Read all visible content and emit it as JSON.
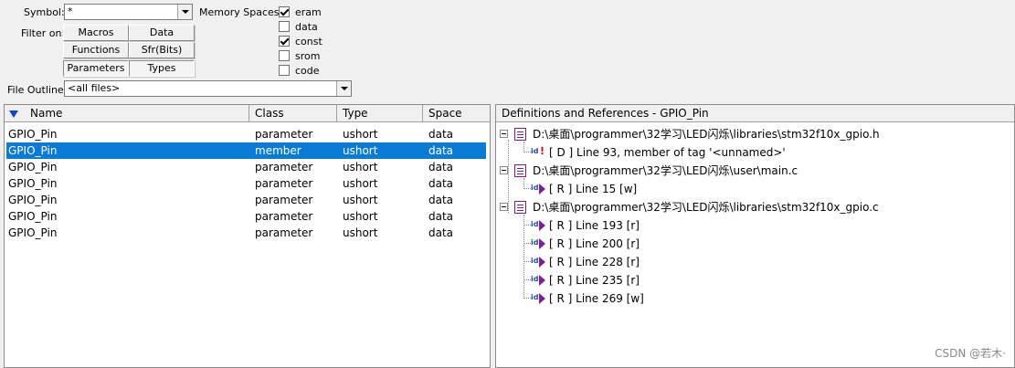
{
  "top": {
    "symbol_label": "Symbol:",
    "symbol_value": "*",
    "filter_label": "Filter on:",
    "filter_buttons": [
      "Macros",
      "Data",
      "Functions",
      "Sfr(Bits)",
      "Parameters",
      "Types"
    ],
    "memory_label": "Memory Spaces:",
    "memory_spaces": [
      {
        "label": "eram",
        "checked": true
      },
      {
        "label": "data",
        "checked": false
      },
      {
        "label": "const",
        "checked": true
      },
      {
        "label": "srom",
        "checked": false
      },
      {
        "label": "code",
        "checked": false
      }
    ],
    "file_outline_label": "File Outline:",
    "file_outline_value": "<all files>"
  },
  "symbols_table": {
    "headers": [
      "Name",
      "Class",
      "Type",
      "Space"
    ],
    "rows": [
      [
        "GPIO_Pin",
        "parameter",
        "ushort",
        "data"
      ],
      [
        "GPIO_Pin",
        "member",
        "ushort",
        "data"
      ],
      [
        "GPIO_Pin",
        "parameter",
        "ushort",
        "data"
      ],
      [
        "GPIO_Pin",
        "parameter",
        "ushort",
        "data"
      ],
      [
        "GPIO_Pin",
        "parameter",
        "ushort",
        "data"
      ],
      [
        "GPIO_Pin",
        "parameter",
        "ushort",
        "data"
      ],
      [
        "GPIO_Pin",
        "parameter",
        "ushort",
        "data"
      ]
    ],
    "selected_row": 1
  },
  "references": {
    "header": "Definitions and References - GPIO_Pin",
    "files": [
      {
        "path": "D:\\桌面\\programmer\\32学习\\LED闪烁\\libraries\\stm32f10x_gpio.h",
        "refs": [
          "[ D ] Line 93, member of tag '<unnamed>'"
        ]
      },
      {
        "path": "D:\\桌面\\programmer\\32学习\\LED闪烁\\user\\main.c",
        "refs": [
          "[ R ] Line 15 [w]"
        ]
      },
      {
        "path": "D:\\桌面\\programmer\\32学习\\LED闪烁\\libraries\\stm32f10x_gpio.c",
        "refs": [
          "[ R ] Line 193 [r]",
          "[ R ] Line 200 [r]",
          "[ R ] Line 228 [r]",
          "[ R ] Line 235 [r]",
          "[ R ] Line 269 [w]"
        ]
      }
    ]
  },
  "watermark": "CSDN @若木·",
  "colors": {
    "selection": "#0a7bd4",
    "sort_arrow": "#1a3fd6",
    "file_icon": "#7a1f7a"
  }
}
